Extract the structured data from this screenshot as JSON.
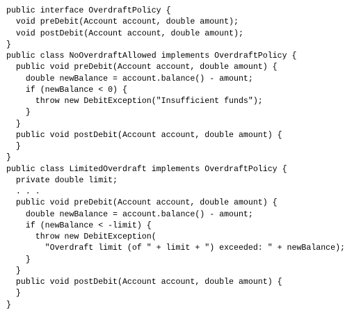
{
  "code_lines": [
    "public interface OverdraftPolicy {",
    "  void preDebit(Account account, double amount);",
    "  void postDebit(Account account, double amount);",
    "}",
    "public class NoOverdraftAllowed implements OverdraftPolicy {",
    "  public void preDebit(Account account, double amount) {",
    "    double newBalance = account.balance() - amount;",
    "    if (newBalance < 0) {",
    "      throw new DebitException(\"Insufficient funds\");",
    "    }",
    "  }",
    "  public void postDebit(Account account, double amount) {",
    "  }",
    "}",
    "public class LimitedOverdraft implements OverdraftPolicy {",
    "  private double limit;",
    "  . . .",
    "  public void preDebit(Account account, double amount) {",
    "    double newBalance = account.balance() - amount;",
    "    if (newBalance < -limit) {",
    "      throw new DebitException(",
    "        \"Overdraft limit (of \" + limit + \") exceeded: \" + newBalance);",
    "    }",
    "  }",
    "  public void postDebit(Account account, double amount) {",
    "  }",
    "}"
  ]
}
